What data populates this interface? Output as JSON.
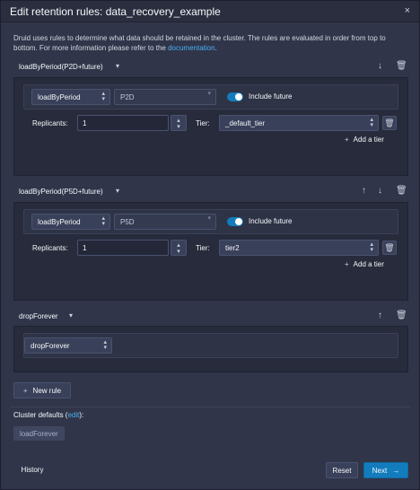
{
  "dialog": {
    "title": "Edit retention rules: data_recovery_example",
    "close_icon": "×"
  },
  "description": {
    "text": "Druid uses rules to determine what data should be retained in the cluster. The rules are evaluated in order from top to bottom. For more information please refer to the ",
    "link": "documentation",
    "end": "."
  },
  "rules": [
    {
      "header": "loadByPeriod(P2D+future)",
      "type": "loadByPeriod",
      "period": "P2D",
      "include_future_label": "Include future",
      "include_future": true,
      "replicants_label": "Replicants:",
      "replicants": "1",
      "tier_label": "Tier:",
      "tier": "_default_tier",
      "add_tier": "Add a tier"
    },
    {
      "header": "loadByPeriod(P5D+future)",
      "type": "loadByPeriod",
      "period": "P5D",
      "include_future_label": "Include future",
      "include_future": true,
      "replicants_label": "Replicants:",
      "replicants": "1",
      "tier_label": "Tier:",
      "tier": "tier2",
      "add_tier": "Add a tier"
    },
    {
      "header": "dropForever",
      "type": "dropForever"
    }
  ],
  "new_rule": "New rule",
  "cluster_defaults": {
    "label": "Cluster defaults (",
    "link": "edit",
    "end": "):",
    "default_rule": "loadForever"
  },
  "footer": {
    "history": "History",
    "reset": "Reset",
    "next": "Next"
  },
  "colors": {
    "accent": "#137cbd",
    "link": "#48aff0",
    "background": "#30354a"
  }
}
